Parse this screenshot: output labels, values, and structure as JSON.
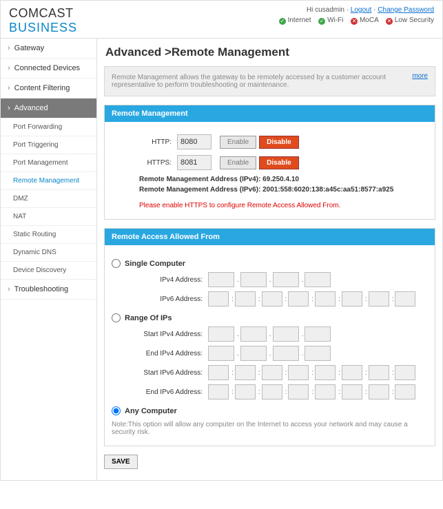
{
  "header": {
    "logo_top": "COMCAST",
    "logo_bottom": "BUSINESS",
    "greeting": "Hi cusadmin",
    "logout": "Logout",
    "change_password": "Change Password",
    "status": {
      "internet": "Internet",
      "wifi": "Wi-Fi",
      "moca": "MoCA",
      "security": "Low Security"
    }
  },
  "nav": {
    "gateway": "Gateway",
    "connected_devices": "Connected Devices",
    "content_filtering": "Content Filtering",
    "advanced": "Advanced",
    "advanced_subs": {
      "port_forwarding": "Port Forwarding",
      "port_triggering": "Port Triggering",
      "port_management": "Port Management",
      "remote_management": "Remote Management",
      "dmz": "DMZ",
      "nat": "NAT",
      "static_routing": "Static Routing",
      "dynamic_dns": "Dynamic DNS",
      "device_discovery": "Device Discovery"
    },
    "troubleshooting": "Troubleshooting"
  },
  "page": {
    "breadcrumb": "Advanced >Remote Management",
    "intro": "Remote Management allows the gateway to be remotely accessed by a customer account representative to perform troubleshooting or maintenance.",
    "more": "more",
    "remote_mgmt_title": "Remote Management",
    "http_label": "HTTP:",
    "http_value": "8080",
    "https_label": "HTTPS:",
    "https_value": "8081",
    "enable": "Enable",
    "disable": "Disable",
    "addr_ipv4": "Remote Management Address (IPv4): 69.250.4.10",
    "addr_ipv6": "Remote Management Address (IPv6): 2001:558:6020:138:a45c:aa51:8577:a925",
    "https_warning": "Please enable HTTPS to configure Remote Access Allowed From.",
    "allowed_title": "Remote Access Allowed From",
    "single_computer": "Single Computer",
    "ipv4_address": "IPv4 Address:",
    "ipv6_address": "IPv6 Address:",
    "range_of_ips": "Range Of IPs",
    "start_ipv4": "Start IPv4 Address:",
    "end_ipv4": "End IPv4 Address:",
    "start_ipv6": "Start IPv6 Address:",
    "end_ipv6": "End IPv6 Address:",
    "any_computer": "Any Computer",
    "note": "Note:This option will allow any computer on the Internet to access your network and may cause a security risk.",
    "save": "SAVE"
  }
}
